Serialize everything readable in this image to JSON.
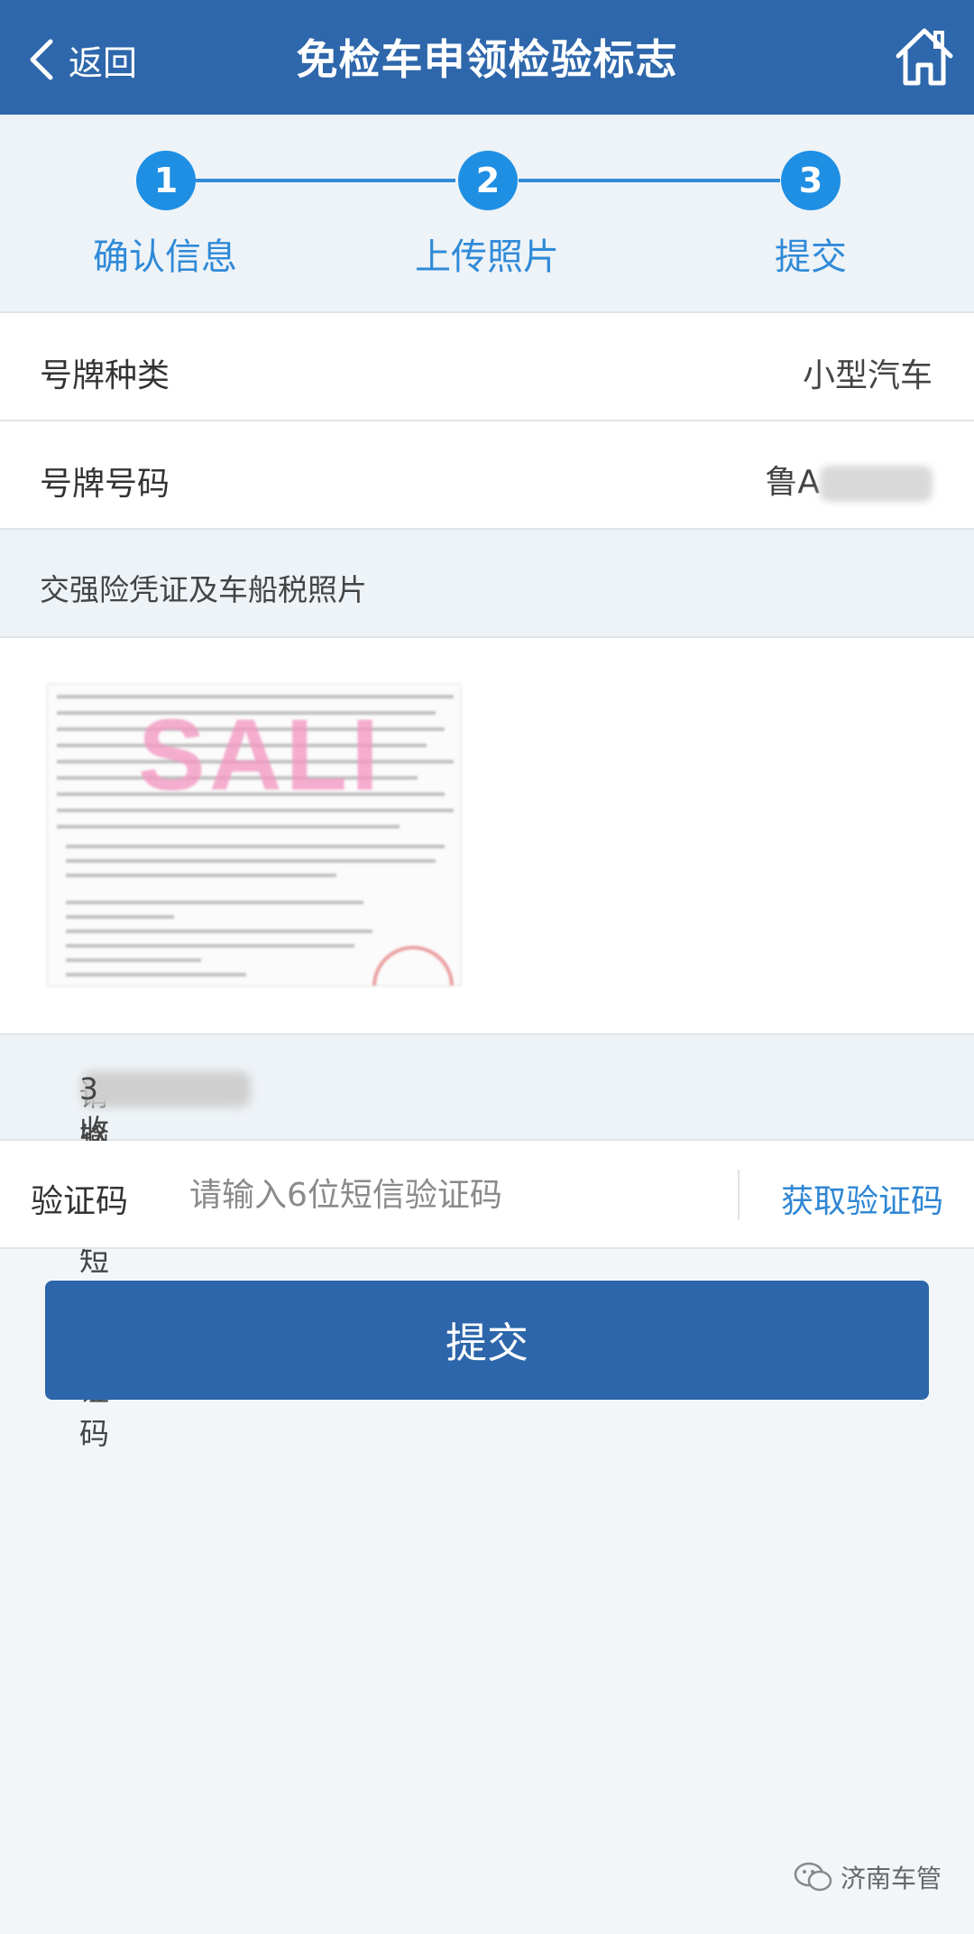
{
  "nav": {
    "back_label": "返回",
    "title": "免检车申领检验标志"
  },
  "steps": [
    {
      "number": "1",
      "label": "确认信息"
    },
    {
      "number": "2",
      "label": "上传照片"
    },
    {
      "number": "3",
      "label": "提交"
    }
  ],
  "plate_type": {
    "label": "号牌种类",
    "value": "小型汽车"
  },
  "plate_number": {
    "label": "号牌号码",
    "value_prefix": "鲁A"
  },
  "photo_section": {
    "title": "交强险凭证及车船税照片",
    "watermark": "SALI"
  },
  "sms_prompt": {
    "prefix": "请输入1",
    "suffix": "3收到的短信验证码"
  },
  "code": {
    "label": "验证码",
    "placeholder": "请输入6位短信验证码",
    "get_code_label": "获取验证码"
  },
  "submit_label": "提交",
  "footer": {
    "text": "济南车管"
  },
  "colors": {
    "primary": "#2e67ab",
    "accent": "#1f8fe3",
    "background": "#f2f6f9"
  },
  "icons": [
    "chevron-left-icon",
    "home-icon",
    "wechat-icon"
  ]
}
